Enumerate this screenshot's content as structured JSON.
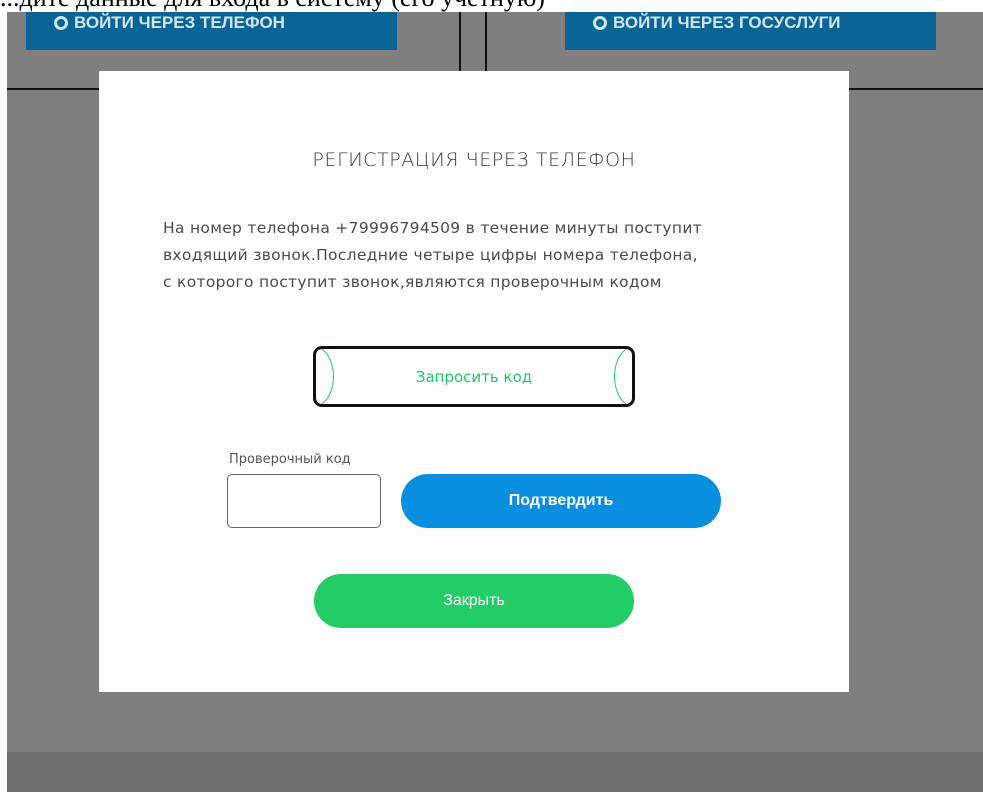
{
  "background": {
    "top_title": "...дите данные для входа в систему (его учётную)",
    "buttons": [
      {
        "label": "ВОЙТИ ЧЕРЕЗ ТЕЛЕФОН",
        "icon": "shield-icon"
      },
      {
        "label": "ВОЙТИ ЧЕРЕЗ ГОСУСЛУГИ",
        "icon": "shield-icon"
      }
    ]
  },
  "modal": {
    "title": "РЕГИСТРАЦИЯ ЧЕРЕЗ ТЕЛЕФОН",
    "text_lines": [
      "На номер телефона +79996794509 в течение минуты поступит",
      "входящий звонок.Последние четыре цифры номера телефона,",
      "с которого поступит звонок,являются проверочным кодом"
    ],
    "request_code_label": "Запросить код",
    "code_field_label": "Проверочный код",
    "code_field_value": "",
    "confirm_label": "Подтвердить",
    "close_label": "Закрыть"
  },
  "colors": {
    "overlay": "#7f7f7f",
    "primary_blue": "#0a8ee0",
    "accent_green": "#22cc67",
    "bg_button_blue": "#0b6496"
  }
}
